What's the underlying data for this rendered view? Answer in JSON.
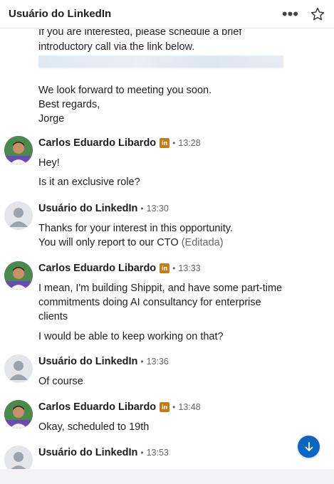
{
  "header": {
    "title": "Usuário do LinkedIn",
    "more_icon": "more-horizontal-icon",
    "star_icon": "star-outline-icon"
  },
  "top_message": {
    "line1": "If you are interested, please schedule a brief",
    "line2": "introductory call via the link below.",
    "closing1": "We look forward to meeting you soon.",
    "closing2": "Best regards,",
    "closing3": "Jorge"
  },
  "messages": [
    {
      "sender": "Carlos Eduardo Libardo",
      "badge": "in",
      "time": "13:28",
      "lines": [
        "Hey!",
        "Is it an exclusive role?"
      ]
    },
    {
      "sender": "Usuário do LinkedIn",
      "time": "13:30",
      "lines": [
        "Thanks for your interest in this opportunity.",
        "You will only report to our CTO"
      ],
      "edited": "(Editada)"
    },
    {
      "sender": "Carlos Eduardo Libardo",
      "badge": "in",
      "time": "13:33",
      "lines": [
        "I mean, I'm building Shippit, and have some part-time",
        "commitments doing AI consultancy for enterprise",
        "clients",
        "I would be able to keep working on that?"
      ]
    },
    {
      "sender": "Usuário do LinkedIn",
      "time": "13:36",
      "lines": [
        "Of course"
      ]
    },
    {
      "sender": "Carlos Eduardo Libardo",
      "badge": "in",
      "time": "13:48",
      "lines": [
        "Okay, scheduled to 19th"
      ]
    },
    {
      "sender": "Usuário do LinkedIn",
      "time": "13:53",
      "lines": []
    }
  ],
  "separator": "•",
  "scroll_button": {
    "icon": "arrow-down-icon"
  },
  "colors": {
    "accent": "#0a66c2",
    "badge": "#c37d16",
    "carlos_avatar": "#5b3c9e",
    "generic_avatar": "#e3e5e8"
  }
}
